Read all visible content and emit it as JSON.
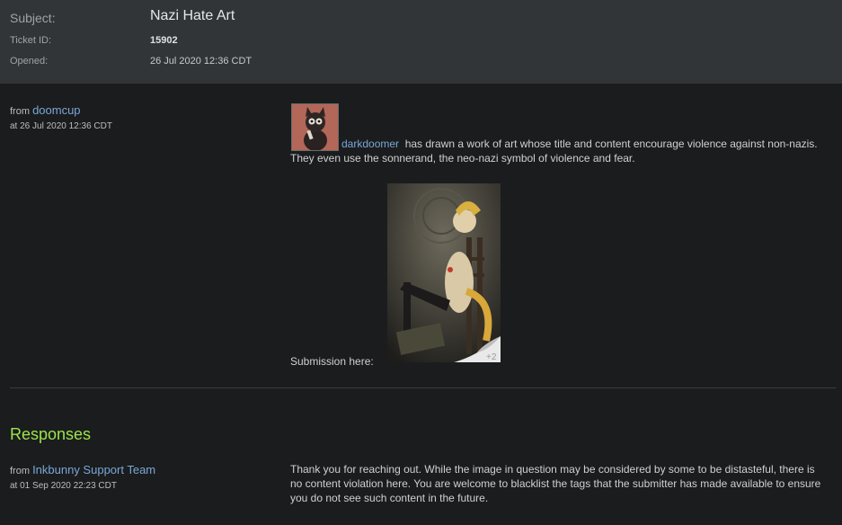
{
  "ticket": {
    "subject_label": "Subject:",
    "subject": "Nazi Hate Art",
    "id_label": "Ticket ID:",
    "id": "15902",
    "opened_label": "Opened:",
    "opened": "26 Jul 2020 12:36 CDT"
  },
  "message": {
    "from_label": "from",
    "author": "doomcup",
    "date": "at 26 Jul 2020 12:36 CDT",
    "mentioned_user": "darkdoomer",
    "text_part1": "has drawn a work of art whose title and content encourage violence against non-nazis. They even use the sonnerand, the neo-nazi symbol of violence and fear.",
    "submission_label": "Submission here:",
    "thumbnail_badge": "+2"
  },
  "responses": {
    "heading": "Responses",
    "items": [
      {
        "from_label": "from",
        "author": "Inkbunny Support Team",
        "date": "at 01 Sep 2020 22:23 CDT",
        "text": "Thank you for reaching out. While the image in question may be considered by some to be distasteful, there is no content violation here. You are welcome to blacklist the tags that the submitter has made available to ensure you do not see such content in the future."
      }
    ]
  },
  "colors": {
    "header_bg": "#323538",
    "page_bg": "#1b1c1e",
    "link": "#7aa7d6",
    "responses_heading": "#9ae64a"
  }
}
